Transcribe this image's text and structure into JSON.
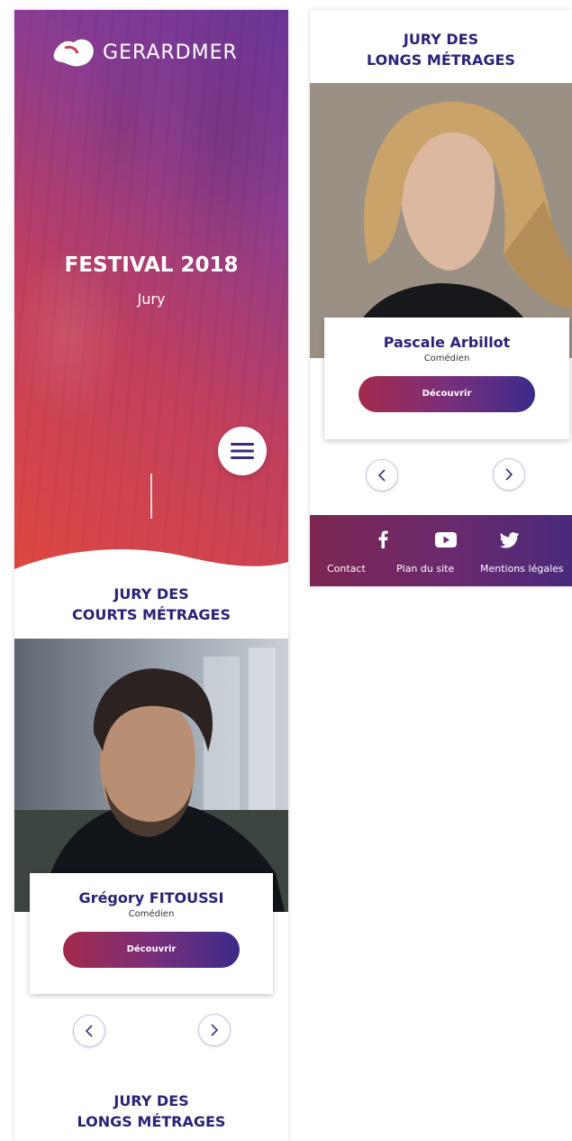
{
  "brand": {
    "logo_text": "GERARDMER"
  },
  "hero": {
    "title": "FESTIVAL 2018",
    "subtitle": "Jury"
  },
  "sections": {
    "courts_title_line1": "JURY DES",
    "courts_title_line2": "COURTS MÉTRAGES",
    "longs_title_line1": "JURY DES",
    "longs_title_line2": "LONGS MÉTRAGES"
  },
  "jury_courts": {
    "name": "Grégory FITOUSSI",
    "role": "Comédien",
    "button": "Découvrir"
  },
  "jury_longs": {
    "name": "Pascale Arbillot",
    "role": "Comédien",
    "button": "Découvrir"
  },
  "footer": {
    "social": [
      "facebook-icon",
      "youtube-icon",
      "twitter-icon"
    ],
    "links": [
      "Contact",
      "Plan du site",
      "Mentions légales"
    ]
  },
  "colors": {
    "accent_navy": "#2a2278",
    "gradient_start": "#e0483f",
    "gradient_end": "#6a3597",
    "footer_bg": "#6a2a6e"
  }
}
